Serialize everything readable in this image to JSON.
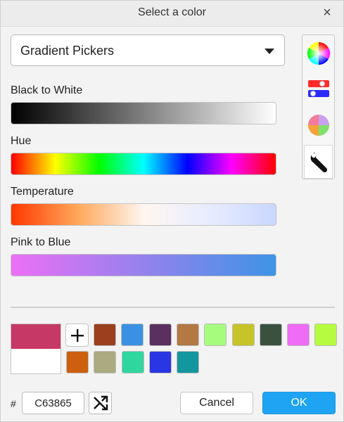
{
  "dialog": {
    "title": "Select a color",
    "close_symbol": "×"
  },
  "picker_select": {
    "value": "Gradient Pickers"
  },
  "side_modes": [
    {
      "name": "color-wheel-icon",
      "active": false
    },
    {
      "name": "sliders-icon",
      "active": false
    },
    {
      "name": "palette-icon",
      "active": false
    },
    {
      "name": "wrench-icon",
      "active": true
    }
  ],
  "gradients": [
    {
      "label": "Black to White"
    },
    {
      "label": "Hue"
    },
    {
      "label": "Temperature"
    },
    {
      "label": "Pink to Blue"
    }
  ],
  "current_color": {
    "new": "#C63865",
    "old": "#FFFFFF"
  },
  "swatches": {
    "row1": [
      "#9B3F1E",
      "#3A91E3",
      "#59305E",
      "#B47842",
      "#A6FC7D",
      "#C7C429",
      "#3A5140",
      "#EF6CF5",
      "#B6FB3F"
    ],
    "row2": [
      "#CC600F",
      "#ABAA80",
      "#2FD69E",
      "#2A35E3",
      "#14969E"
    ]
  },
  "hex": {
    "prefix": "#",
    "value": "C63865"
  },
  "buttons": {
    "cancel": "Cancel",
    "ok": "OK"
  }
}
